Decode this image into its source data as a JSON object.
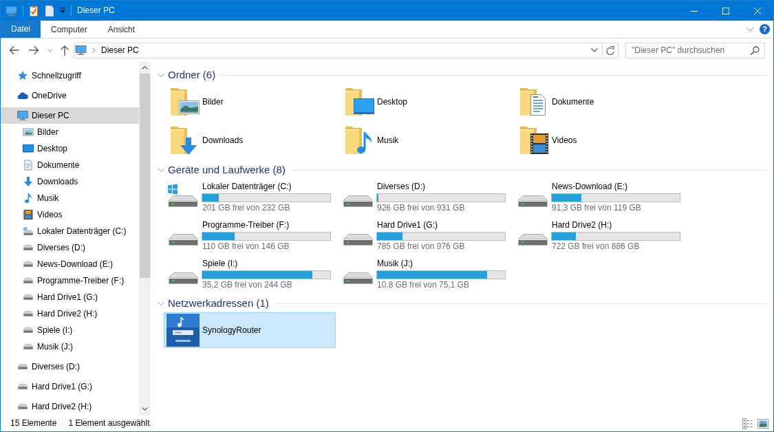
{
  "window": {
    "title": "Dieser PC"
  },
  "ribbon": {
    "file_button": "Datei",
    "tabs": [
      {
        "label": "Computer",
        "selected": false
      },
      {
        "label": "Ansicht",
        "selected": false
      }
    ],
    "help": "?"
  },
  "address_bar": {
    "path": [
      "Dieser PC"
    ]
  },
  "search": {
    "placeholder": "\"Dieser PC\" durchsuchen"
  },
  "sidebar": {
    "items": [
      {
        "label": "Schnellzugriff",
        "kind": "quick-access",
        "selected": false
      },
      {
        "label": "OneDrive",
        "kind": "cloud",
        "selected": false
      },
      {
        "label": "Dieser PC",
        "kind": "pc",
        "selected": true,
        "children": [
          {
            "label": "Bilder",
            "kind": "pictures",
            "selected": false
          },
          {
            "label": "Desktop",
            "kind": "desktop",
            "selected": false
          },
          {
            "label": "Dokumente",
            "kind": "documents",
            "selected": false
          },
          {
            "label": "Downloads",
            "kind": "downloads",
            "selected": false
          },
          {
            "label": "Musik",
            "kind": "music",
            "selected": false
          },
          {
            "label": "Videos",
            "kind": "videos",
            "selected": false
          },
          {
            "label": "Lokaler Datenträger (C:)",
            "kind": "system-drive",
            "selected": false
          },
          {
            "label": "Diverses (D:)",
            "kind": "drive",
            "selected": false
          },
          {
            "label": "News-Download (E:)",
            "kind": "drive",
            "selected": false
          },
          {
            "label": "Programme-Treiber (F:)",
            "kind": "drive",
            "selected": false
          },
          {
            "label": "Hard Drive1 (G:)",
            "kind": "drive",
            "selected": false
          },
          {
            "label": "Hard Drive2 (H:)",
            "kind": "drive",
            "selected": false
          },
          {
            "label": "Spiele (I:)",
            "kind": "drive",
            "selected": false
          },
          {
            "label": "Musik (J:)",
            "kind": "drive",
            "selected": false
          }
        ]
      },
      {
        "label": "Diverses (D:)",
        "kind": "drive",
        "selected": false
      },
      {
        "label": "Hard Drive1 (G:)",
        "kind": "drive",
        "selected": false
      },
      {
        "label": "Hard Drive2 (H:)",
        "kind": "drive",
        "selected": false
      }
    ]
  },
  "groups": [
    {
      "title": "Ordner (6)",
      "kind": "folders",
      "expanded": true,
      "items": [
        {
          "name": "Bilder",
          "kind": "pictures",
          "selected": false
        },
        {
          "name": "Desktop",
          "kind": "desktop",
          "selected": false
        },
        {
          "name": "Dokumente",
          "kind": "documents",
          "selected": false
        },
        {
          "name": "Downloads",
          "kind": "downloads",
          "selected": false
        },
        {
          "name": "Musik",
          "kind": "music",
          "selected": false
        },
        {
          "name": "Videos",
          "kind": "videos",
          "selected": false
        }
      ]
    },
    {
      "title": "Geräte und Laufwerke (8)",
      "kind": "drives",
      "expanded": true,
      "items": [
        {
          "name": "Lokaler Datenträger (C:)",
          "kind": "system-drive",
          "level": 0.13,
          "free": "201 GB frei von 232 GB",
          "selected": false
        },
        {
          "name": "Diverses (D:)",
          "kind": "drive",
          "level": 0.01,
          "free": "926 GB frei von 931 GB",
          "selected": false
        },
        {
          "name": "News-Download (E:)",
          "kind": "drive",
          "level": 0.23,
          "free": "91,3 GB frei von 119 GB",
          "selected": false
        },
        {
          "name": "Programme-Treiber (F:)",
          "kind": "drive",
          "level": 0.25,
          "free": "110 GB frei von 146 GB",
          "selected": false
        },
        {
          "name": "Hard Drive1 (G:)",
          "kind": "drive",
          "level": 0.2,
          "free": "785 GB frei von 976 GB",
          "selected": false
        },
        {
          "name": "Hard Drive2 (H:)",
          "kind": "drive",
          "level": 0.19,
          "free": "722 GB frei von 886 GB",
          "selected": false
        },
        {
          "name": "Spiele (I:)",
          "kind": "drive",
          "level": 0.86,
          "free": "35,2 GB frei von 244 GB",
          "selected": false
        },
        {
          "name": "Musik (J:)",
          "kind": "drive",
          "level": 0.86,
          "free": "10,8 GB frei von 75,1 GB",
          "selected": false
        }
      ]
    },
    {
      "title": "Netzwerkadressen (1)",
      "kind": "network",
      "expanded": true,
      "items": [
        {
          "name": "SynologyRouter",
          "kind": "nas",
          "selected": true
        }
      ]
    }
  ],
  "status_bar": {
    "item_count": "15 Elemente",
    "selection": "1 Element ausgewählt"
  }
}
